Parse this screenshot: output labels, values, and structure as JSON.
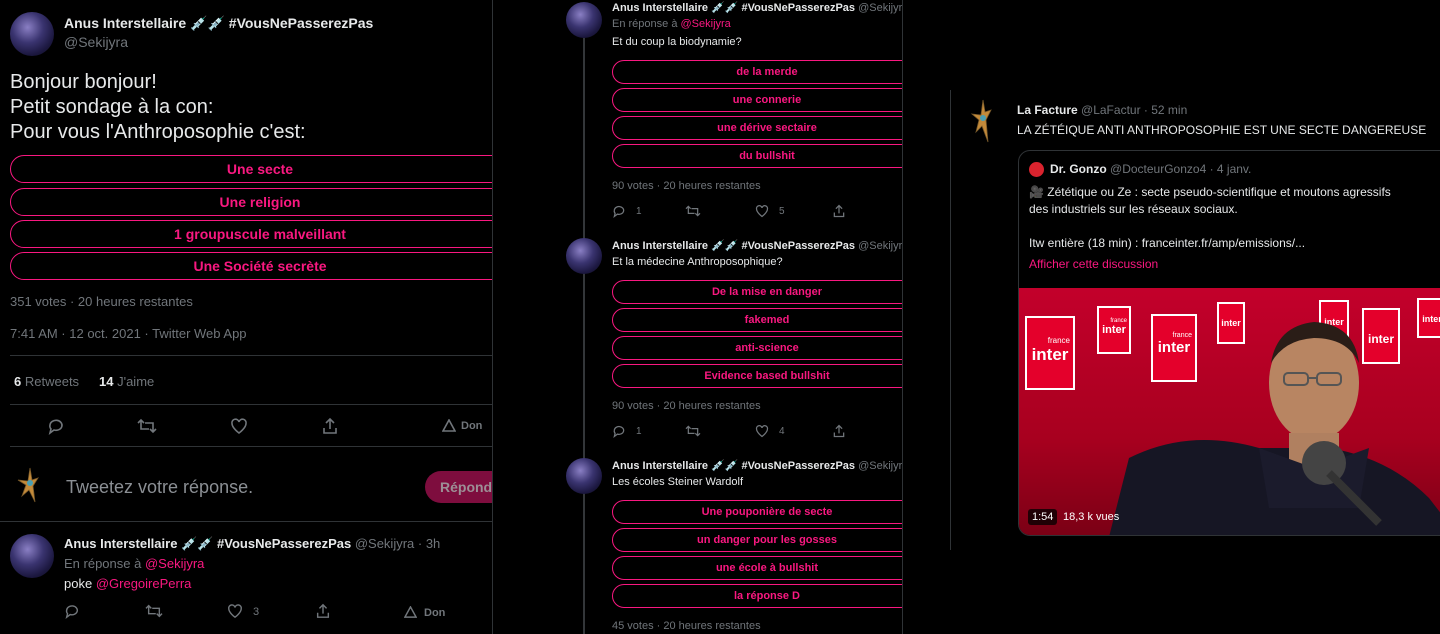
{
  "panel1": {
    "author": {
      "name": "Anus Interstellaire 💉💉 #VousNePasserezPas",
      "handle": "@Sekijyra"
    },
    "text_lines": [
      "Bonjour bonjour!",
      "Petit sondage à la con:",
      "Pour vous l'Anthroposophie c'est:"
    ],
    "poll_options": [
      "Une secte",
      "Une religion",
      "1 groupuscule malveillant",
      "Une Société secrète"
    ],
    "poll_meta": "351 votes · 20 heures restantes",
    "timestamp": "7:41 AM · 12 oct. 2021 · Twitter Web App",
    "retweets_count": "6",
    "retweets_label": "Retweets",
    "likes_count": "14",
    "likes_label": "J'aime",
    "promote_label": "Don",
    "reply_placeholder": "Tweetez votre réponse.",
    "reply_button": "Répondre",
    "reply": {
      "name": "Anus Interstellaire 💉💉 #VousNePasserezPas",
      "handle_time": "@Sekijyra · 3h",
      "in_reply_prefix": "En réponse à",
      "in_reply_handle": "@Sekijyra",
      "text_prefix": "poke",
      "text_mention": "@GregoirePerra",
      "likes": "3",
      "promote_label": "Don"
    }
  },
  "panel2": {
    "tweets": [
      {
        "name": "Anus Interstellaire 💉💉 #VousNePasserezPas",
        "handle": "@Sekijyra",
        "in_reply_prefix": "En réponse à",
        "in_reply_handle": "@Sekijyra",
        "question": "Et du coup la biodynamie?",
        "options": [
          "de la merde",
          "une connerie",
          "une dérive sectaire",
          "du bullshit"
        ],
        "meta": "90 votes · 20 heures restantes",
        "replies": "1",
        "likes": "5"
      },
      {
        "name": "Anus Interstellaire 💉💉 #VousNePasserezPas",
        "handle": "@Sekijyra",
        "question": "Et la médecine Anthroposophique?",
        "options": [
          "De la mise en danger",
          "fakemed",
          "anti-science",
          "Evidence based bullshit"
        ],
        "meta": "90 votes · 20 heures restantes",
        "replies": "1",
        "likes": "4"
      },
      {
        "name": "Anus Interstellaire 💉💉 #VousNePasserezPas",
        "handle": "@Sekijyra",
        "question": "Les écoles Steiner Wardolf",
        "options": [
          "Une pouponière de secte",
          "un danger pour les gosses",
          "une école à bullshit",
          "la réponse D"
        ],
        "meta": "45 votes · 20 heures restantes"
      }
    ]
  },
  "panel3": {
    "name": "La Facture",
    "handle_time": "@LaFactur · 52 min",
    "text": "LA ZÉTÉIQUE ANTI ANTHROPOSOPHIE EST UNE SECTE DANGEREUSE",
    "quoted": {
      "name": "Dr. Gonzo",
      "handle_time": "@DocteurGonzo4 · 4 janv.",
      "text_line1": "🎥 Zététique ou Ze : secte pseudo-scientifique et moutons agressifs",
      "text_line2": "des industriels sur les réseaux sociaux.",
      "text_line3": "Itw entière (18 min) : franceinter.fr/amp/emissions/...",
      "show_thread": "Afficher cette discussion",
      "video_duration": "1:54",
      "video_views": "18,3 k vues",
      "logo_small": "france",
      "logo_big": "inter"
    }
  },
  "colors": {
    "accent": "#f91880",
    "background": "#000000",
    "text": "#e7e9ea",
    "muted": "#71767b",
    "border": "#2f3336"
  }
}
